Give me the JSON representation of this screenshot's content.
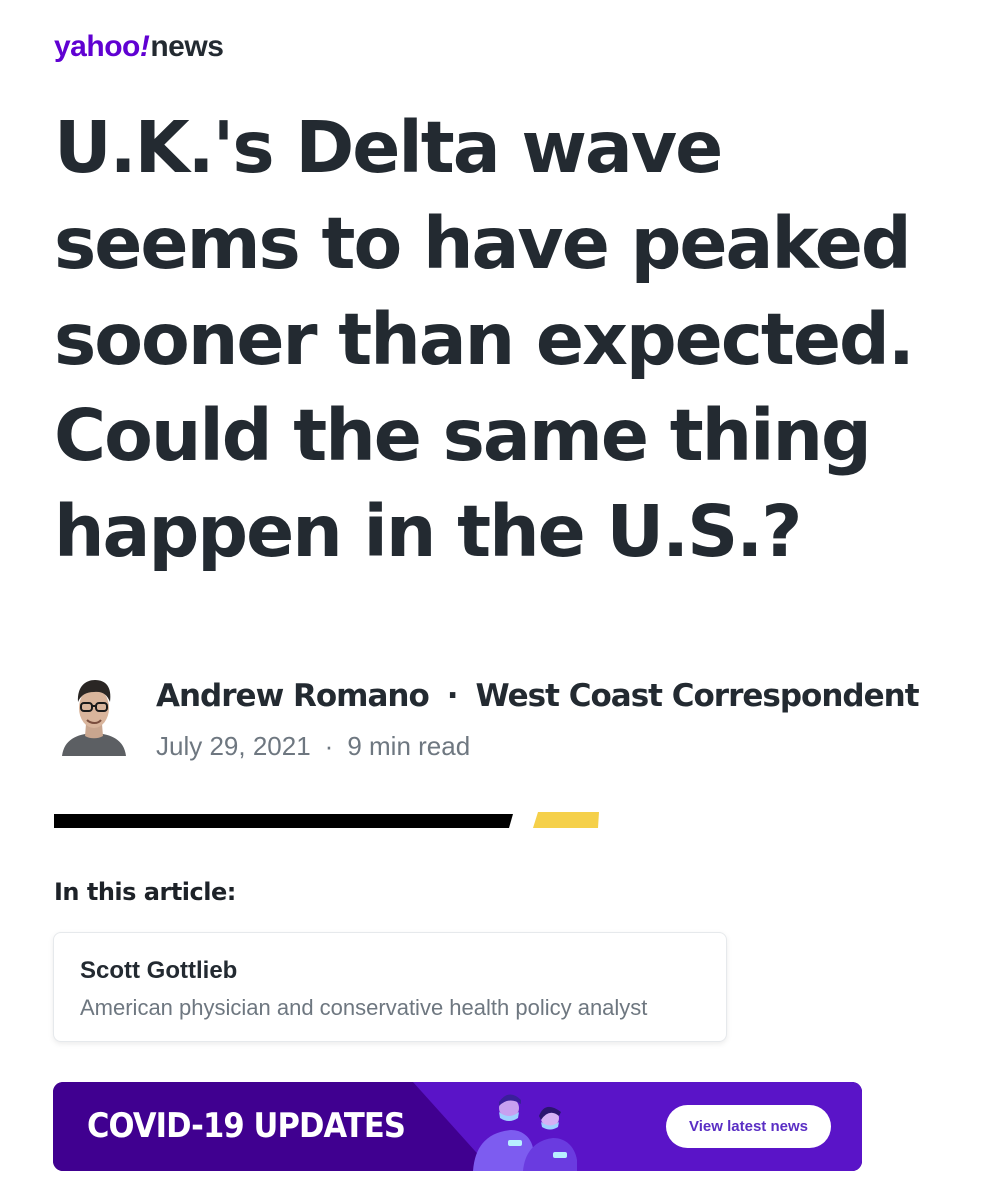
{
  "logo": {
    "brand": "yahoo",
    "bang": "!",
    "section": "news"
  },
  "article": {
    "headline": "U.K.'s Delta wave seems to have peaked sooner than expected. Could the same thing happen in the U.S.?",
    "author": {
      "name": "Andrew Romano",
      "separator": "·",
      "title": "West Coast Correspondent"
    },
    "date": "July 29, 2021",
    "date_separator": "·",
    "read_time": "9 min read"
  },
  "in_article": {
    "label": "In this article:",
    "entity": {
      "name": "Scott Gottlieb",
      "description": "American physician and conservative health policy analyst"
    }
  },
  "covid_banner": {
    "title": "COVID-19 UPDATES",
    "button_label": "View latest news"
  },
  "colors": {
    "brand_purple": "#6001d2",
    "text_dark": "#232a31",
    "text_muted": "#6e7780",
    "accent_yellow": "#f5d04a",
    "banner_purple": "#400090"
  }
}
